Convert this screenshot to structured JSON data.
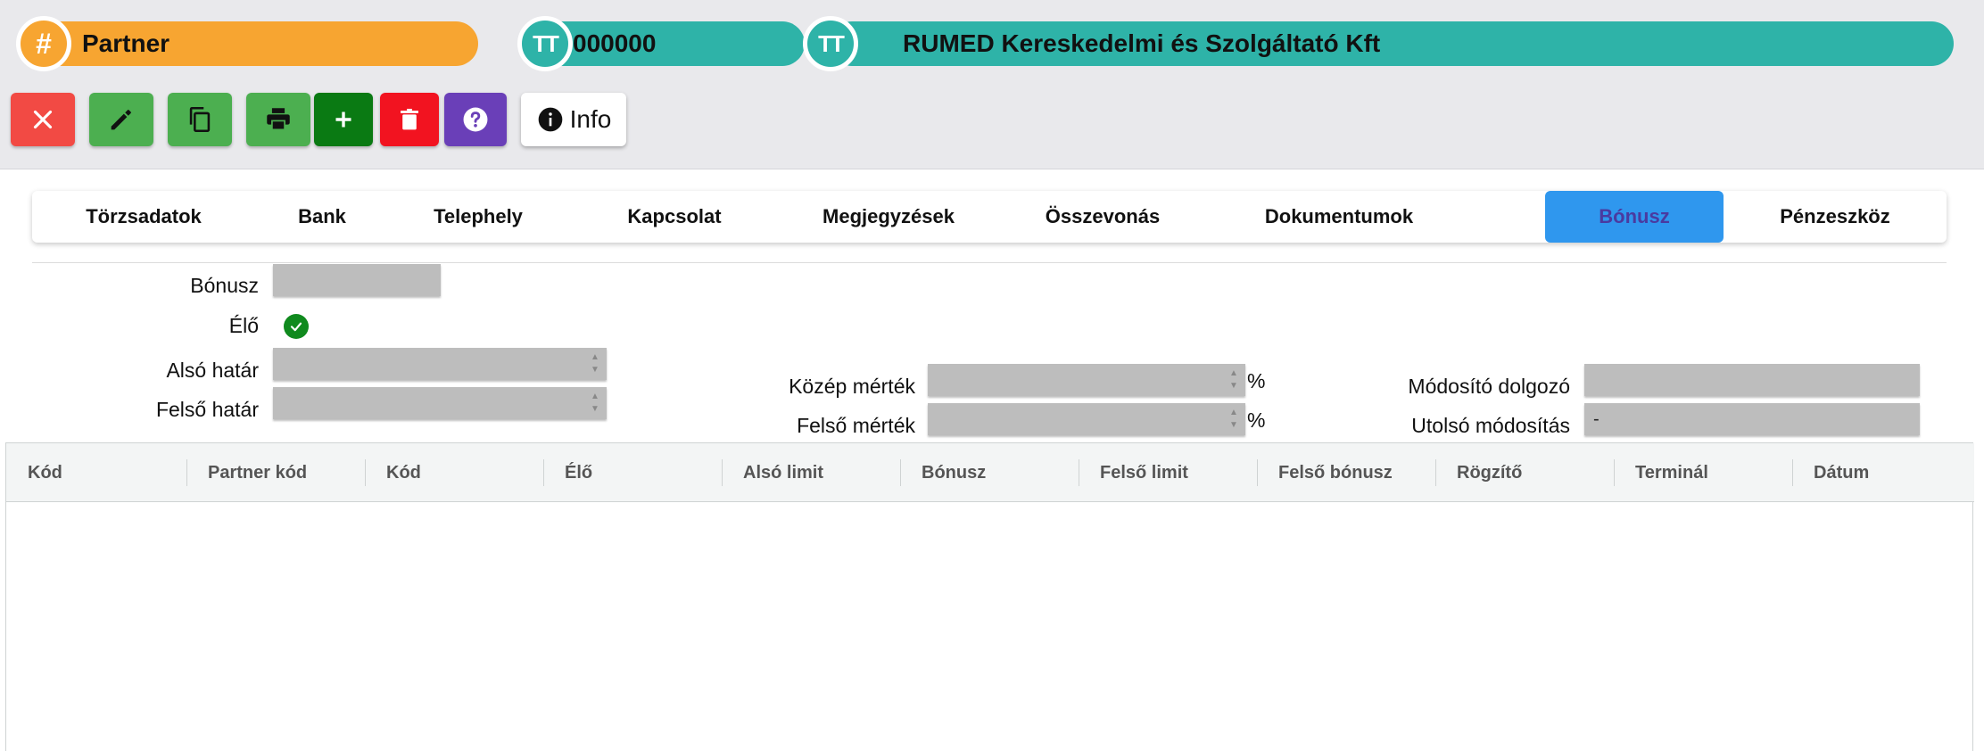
{
  "header": {
    "partner_label": "Partner",
    "partner_code": "000000",
    "partner_name": "RUMED Kereskedelmi és Szolgáltató Kft",
    "hash_glyph": "#",
    "text_type_glyph": "TT",
    "colors": {
      "orange": "#f7a531",
      "teal": "#2eb3a8"
    }
  },
  "toolbar": {
    "buttons": [
      {
        "name": "close",
        "icon": "close-icon",
        "color": "#f24a44"
      },
      {
        "name": "edit",
        "icon": "pencil-icon",
        "color": "#4caf50"
      },
      {
        "name": "copy",
        "icon": "copy-icon",
        "color": "#4caf50"
      },
      {
        "name": "print",
        "icon": "printer-icon",
        "color": "#4caf50"
      },
      {
        "name": "add",
        "icon": "plus-icon",
        "color": "#0a7a13"
      },
      {
        "name": "delete",
        "icon": "trash-icon",
        "color": "#f21320"
      },
      {
        "name": "help",
        "icon": "question-icon",
        "color": "#6a3fb8"
      }
    ],
    "info_label": "Info"
  },
  "tabs": [
    {
      "label": "Törzsadatok",
      "active": false
    },
    {
      "label": "Bank",
      "active": false
    },
    {
      "label": "Telephely",
      "active": false
    },
    {
      "label": "Kapcsolat",
      "active": false
    },
    {
      "label": "Megjegyzések",
      "active": false
    },
    {
      "label": "Összevonás",
      "active": false
    },
    {
      "label": "Dokumentumok",
      "active": false
    },
    {
      "label": "Bónusz",
      "active": true
    },
    {
      "label": "Pénzeszköz",
      "active": false
    }
  ],
  "form": {
    "bonusz_label": "Bónusz",
    "bonusz_value": "",
    "elo_label": "Élő",
    "elo_checked": true,
    "also_hatar_label": "Alsó határ",
    "also_hatar_value": "",
    "felso_hatar_label": "Felső határ",
    "felso_hatar_value": "",
    "kozep_merték_label": "Közép mérték",
    "kozep_merték_value": "",
    "felso_merték_label": "Felső mérték",
    "felso_merték_value": "",
    "percent": "%",
    "modosito_label": "Módosító dolgozó",
    "modosito_value": "",
    "utolso_label": "Utolsó módosítás",
    "utolso_value": "-"
  },
  "grid": {
    "columns": [
      "Kód",
      "Partner kód",
      "Kód",
      "Élő",
      "Alsó limit",
      "Bónusz",
      "Felső limit",
      "Felső bónusz",
      "Rögzítő",
      "Terminál",
      "Dátum"
    ],
    "rows": []
  }
}
